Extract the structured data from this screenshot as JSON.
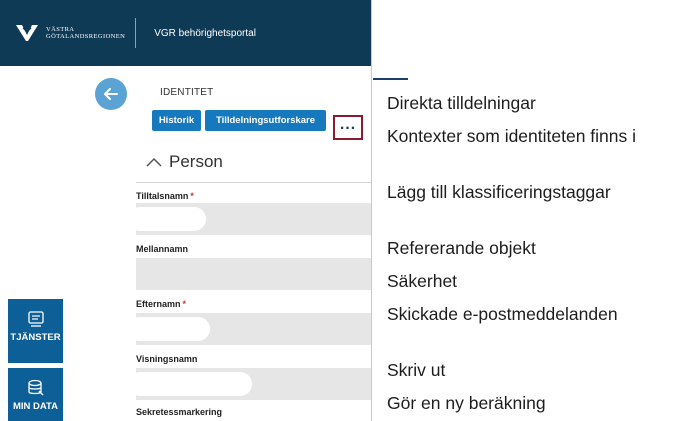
{
  "header": {
    "logo_text_line1": "Västra",
    "logo_text_line2": "Götalandsregionen",
    "portal_title": "VGR behörighetsportal"
  },
  "nav": {
    "items": [
      {
        "label": "TJÄNSTER",
        "icon": "services-icon"
      },
      {
        "label": "MIN DATA",
        "icon": "database-icon"
      }
    ]
  },
  "page": {
    "section_label": "IDENTITET",
    "buttons": {
      "historik": "Historik",
      "tilldelningsutforskare": "Tilldelningsutforskare",
      "more": "..."
    },
    "section_title": "Person",
    "fields": [
      {
        "label": "Tilltalsnamn",
        "required": "*",
        "value": ""
      },
      {
        "label": "Mellannamn",
        "required": "",
        "value": ""
      },
      {
        "label": "Efternamn",
        "required": "*",
        "value": ""
      },
      {
        "label": "Visningsnamn",
        "required": "",
        "value": ""
      },
      {
        "label": "Sekretessmarkering",
        "required": "",
        "value": ""
      }
    ]
  },
  "context_menu": {
    "items": [
      "Direkta tilldelningar",
      "Kontexter som identiteten finns i",
      "Lägg till klassificeringstaggar",
      "Refererande objekt",
      "Säkerhet",
      "Skickade e-postmeddelanden",
      "Skriv ut",
      "Gör en ny beräkning"
    ]
  },
  "colors": {
    "header_bg": "#0f3a56",
    "nav_bg": "#0d5f97",
    "button_bg": "#1679bd",
    "back_button": "#5ba3d3",
    "highlight_border": "#8b1a2e",
    "required": "#c0392b"
  }
}
